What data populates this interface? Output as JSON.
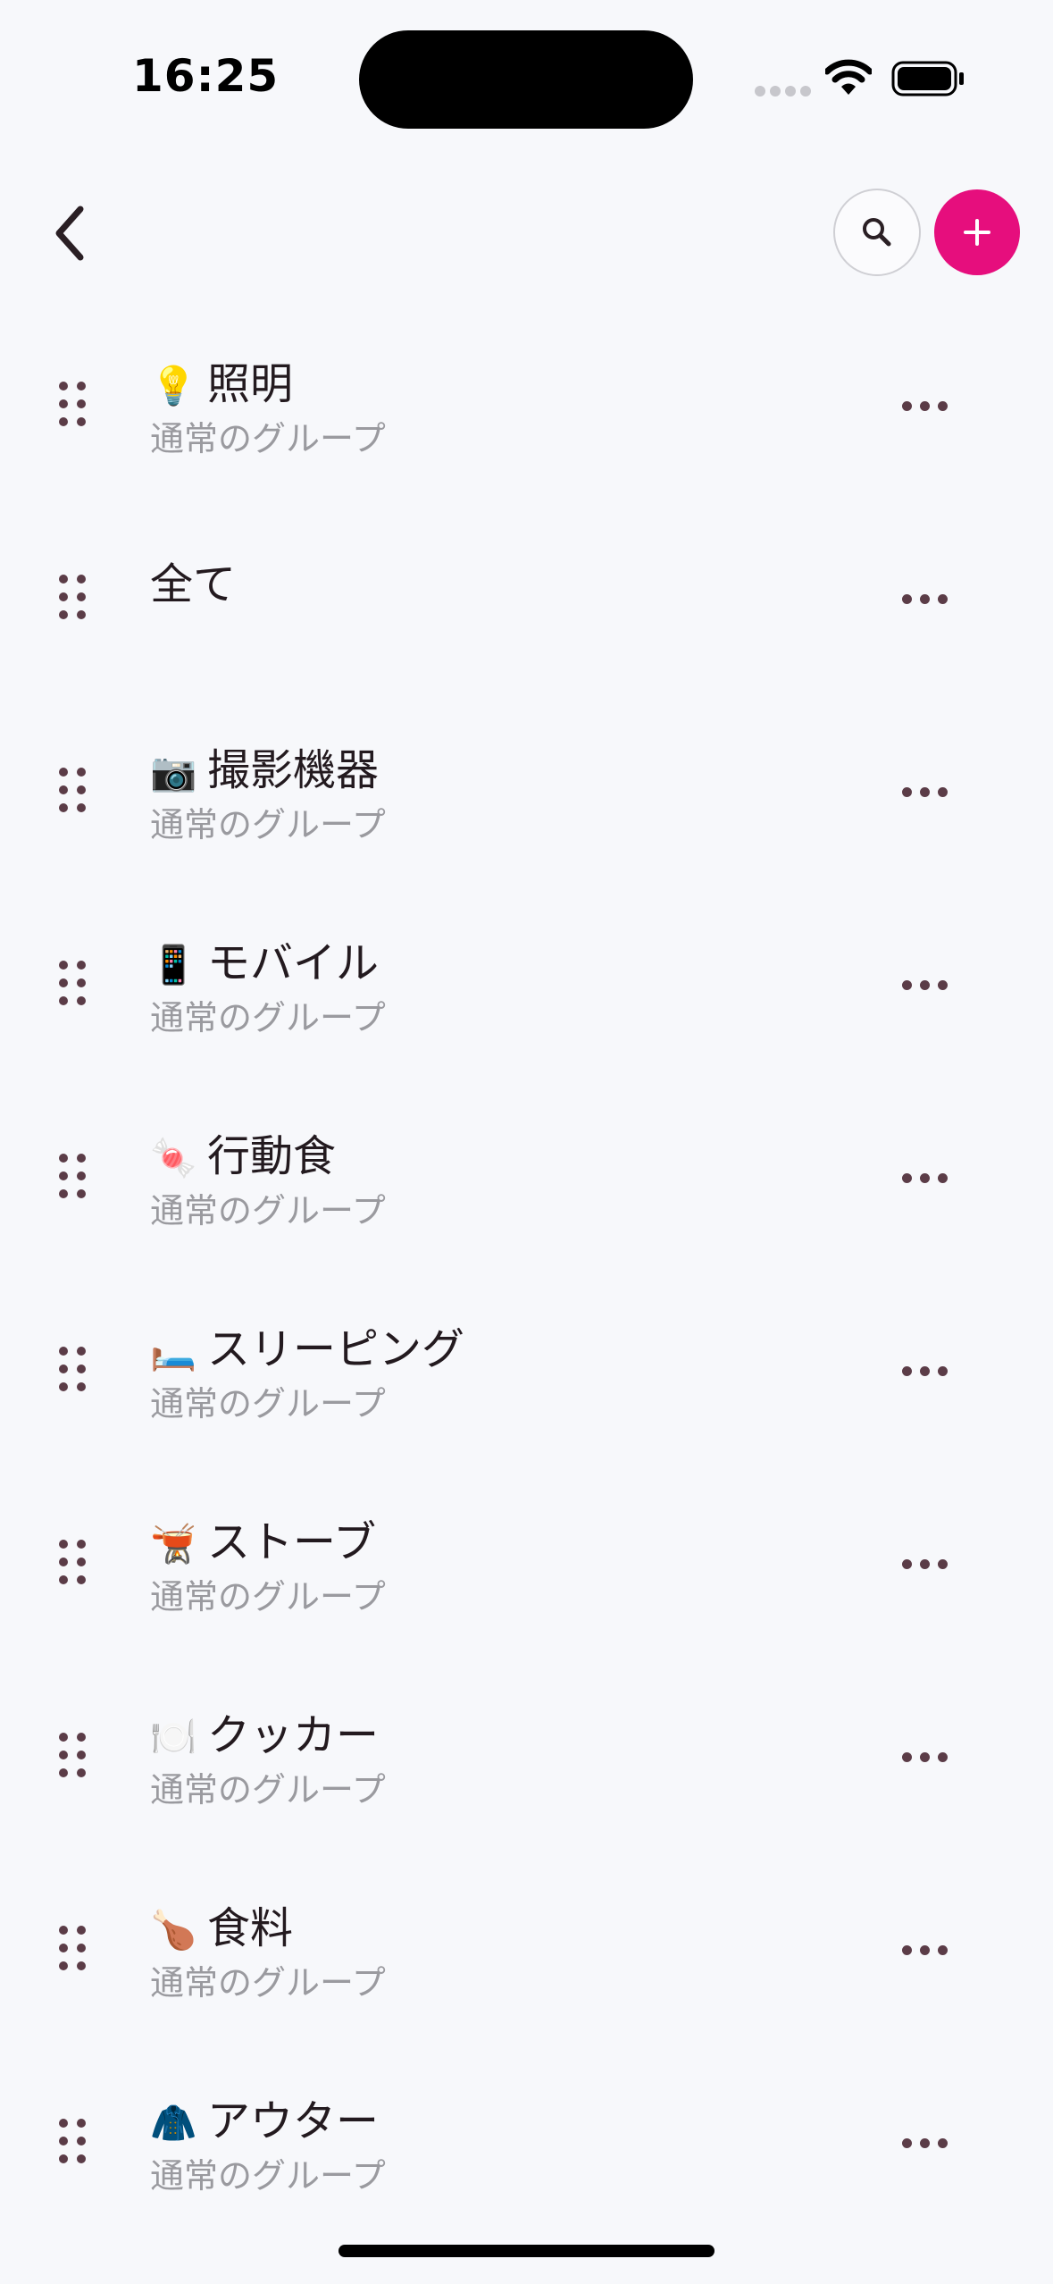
{
  "status_bar": {
    "time": "16:25"
  },
  "nav": {
    "back_icon": "chevron-left-icon",
    "search_icon": "magnifier-icon",
    "add_icon": "plus-icon",
    "accent_color": "#e60e7d"
  },
  "groups": [
    {
      "emoji": "💡",
      "name": "照明",
      "subtitle": "通常のグループ"
    },
    {
      "emoji": "",
      "name": "全て",
      "subtitle": ""
    },
    {
      "emoji": "📷",
      "name": "撮影機器",
      "subtitle": "通常のグループ"
    },
    {
      "emoji": "📱",
      "name": "モバイル",
      "subtitle": "通常のグループ"
    },
    {
      "emoji": "🍬",
      "name": "行動食",
      "subtitle": "通常のグループ"
    },
    {
      "emoji": "🛏️",
      "name": "スリーピング",
      "subtitle": "通常のグループ"
    },
    {
      "emoji": "🫕",
      "name": "ストーブ",
      "subtitle": "通常のグループ"
    },
    {
      "emoji": "🍽️",
      "name": "クッカー",
      "subtitle": "通常のグループ"
    },
    {
      "emoji": "🍗",
      "name": "食料",
      "subtitle": "通常のグループ"
    },
    {
      "emoji": "🧥",
      "name": "アウター",
      "subtitle": "通常のグループ"
    }
  ]
}
